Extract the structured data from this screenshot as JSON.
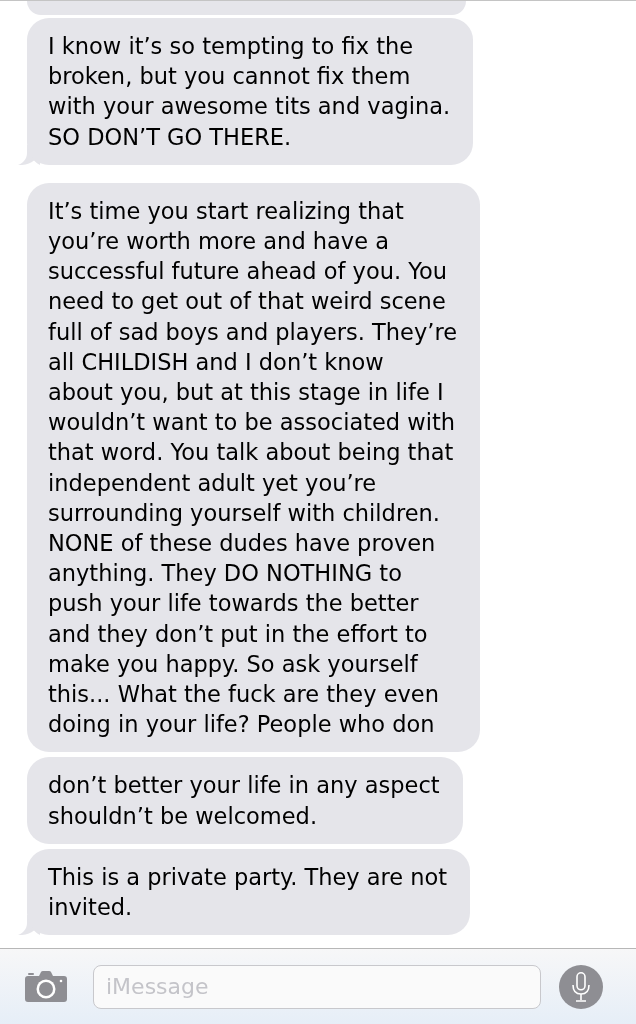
{
  "conversation": {
    "clipped_message_above": true,
    "messages": [
      {
        "lines": [
          "I know it’s so tempting to fix the",
          "broken, but you cannot fix them",
          "with your awesome tits and vagina.",
          "SO DON’T GO THERE."
        ],
        "tail": true
      },
      {
        "lines": [
          "It’s time you start realizing that",
          "you’re worth more and have a",
          "successful future ahead of you. You",
          "need to get out of that weird scene",
          "full of sad boys and players. They’re",
          "all CHILDISH and I don’t know",
          "about you, but at this stage in life I",
          "wouldn’t want to be associated with",
          "that word. You talk about being that",
          "independent adult yet you’re",
          "surrounding yourself with children.",
          "NONE of these dudes have proven",
          "anything. They DO NOTHING to",
          "push your life towards the better",
          "and they don’t put in the effort to",
          "make you happy. So ask yourself",
          "this... What the fuck are they even",
          "doing in your life? People who don"
        ],
        "tail": false
      },
      {
        "lines": [
          "don’t better your life in any aspect",
          "shouldn’t be welcomed."
        ],
        "tail": false
      },
      {
        "lines": [
          "This is a private party. They are not",
          "invited."
        ],
        "tail": true
      }
    ]
  },
  "input_bar": {
    "placeholder": "iMessage"
  }
}
